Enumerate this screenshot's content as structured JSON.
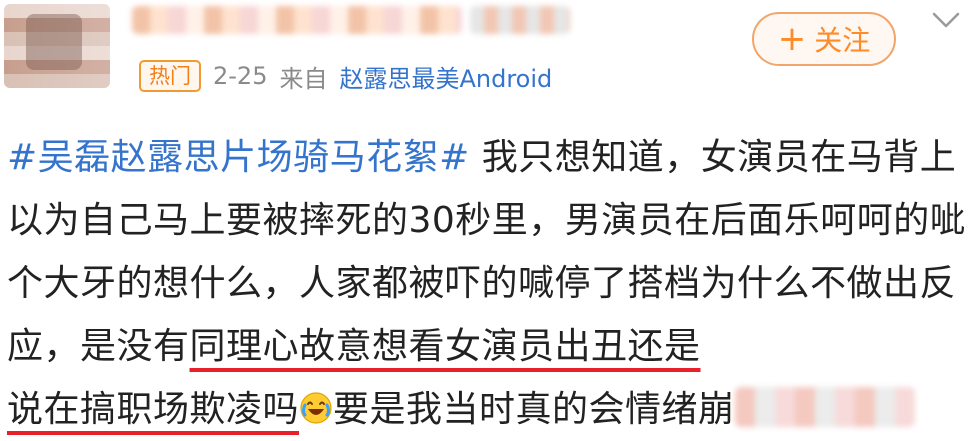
{
  "post": {
    "badge": "热门",
    "date": "2-25",
    "source_prefix": "来自",
    "source_device": "赵露思最美Android",
    "follow_label": "关注",
    "hashtag": "#吴磊赵露思片场骑马花絮#",
    "text_part1": "我只想知道，女演员在马背上以为自己马上要被摔死的30秒里，男演员在后面乐呵呵的呲个大牙的想什么，人家都被吓的喊停了搭档为什么不做出反应，是没有",
    "text_underlined1": "同理心故意想看女演员出丑还是",
    "text_underlined2": "说在搞职场欺凌吗",
    "text_part2": "要是我当时真的会情绪崩"
  },
  "colors": {
    "link": "#3574cc",
    "accent": "#ff8a28",
    "underline": "#e8202a",
    "meta": "#8a8a8a"
  },
  "icons": {
    "avatar": "avatar-image",
    "chevron": "chevron-down-icon",
    "emoji": "crying-laughing-emoji"
  }
}
